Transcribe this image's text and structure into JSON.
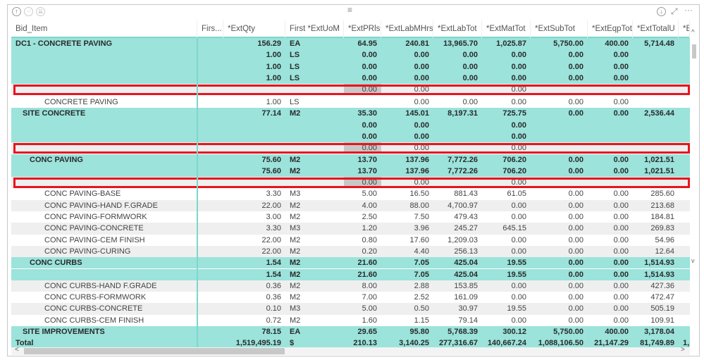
{
  "toolbar": {
    "drill_up": "↑",
    "drill_down": "↓↓",
    "expand": "⇊",
    "focus_mode": "⤢",
    "more": "···",
    "drag": "≡",
    "download": "↓"
  },
  "columns": [
    "Bid_Item",
    "Firs...",
    "*ExtQty",
    "First *ExtUoM",
    "*ExtPRls",
    "*ExtLabMHrs",
    "*ExtLabTot",
    "*ExtMatTot",
    "*ExtSubTot",
    "*ExtEqpTot",
    "*ExtTotalU",
    "*E"
  ],
  "colors": {
    "highlight": "#9be3db",
    "selection_box": "#e8141e",
    "stripe": "#efefef"
  },
  "rows": [
    {
      "style": "teal",
      "bold": true,
      "indent": 0,
      "cells": [
        "DC1 - CONCRETE PAVING",
        "",
        "156.29",
        "EA",
        "64.95",
        "240.81",
        "13,965.70",
        "1,025.87",
        "5,750.00",
        "400.00",
        "5,714.48",
        ""
      ]
    },
    {
      "style": "teal",
      "bold": true,
      "indent": 0,
      "cells": [
        "",
        "",
        "1.00",
        "LS",
        "0.00",
        "0.00",
        "0.00",
        "0.00",
        "0.00",
        "0.00",
        "",
        ""
      ]
    },
    {
      "style": "teal",
      "bold": true,
      "indent": 0,
      "cells": [
        "",
        "",
        "1.00",
        "LS",
        "0.00",
        "0.00",
        "0.00",
        "0.00",
        "0.00",
        "0.00",
        "",
        ""
      ]
    },
    {
      "style": "teal",
      "bold": true,
      "indent": 0,
      "cells": [
        "",
        "",
        "1.00",
        "LS",
        "0.00",
        "0.00",
        "0.00",
        "0.00",
        "0.00",
        "0.00",
        "",
        ""
      ]
    },
    {
      "style": "grey",
      "bold": false,
      "indent": 0,
      "selected": true,
      "cells": [
        "",
        "",
        "",
        "",
        "0.00",
        "0.00",
        "",
        "0.00",
        "",
        "",
        "",
        ""
      ]
    },
    {
      "style": "white",
      "bold": false,
      "indent": 3,
      "cells": [
        "CONCRETE PAVING",
        "",
        "1.00",
        "LS",
        "",
        "0.00",
        "0.00",
        "0.00",
        "0.00",
        "0.00",
        "",
        ""
      ]
    },
    {
      "style": "teal",
      "bold": true,
      "indent": 1,
      "cells": [
        "SITE CONCRETE",
        "",
        "77.14",
        "M2",
        "35.30",
        "145.01",
        "8,197.31",
        "725.75",
        "0.00",
        "0.00",
        "2,536.44",
        ""
      ]
    },
    {
      "style": "teal",
      "bold": true,
      "indent": 0,
      "cells": [
        "",
        "",
        "",
        "",
        "0.00",
        "0.00",
        "",
        "0.00",
        "",
        "",
        "",
        ""
      ]
    },
    {
      "style": "teal",
      "bold": true,
      "indent": 0,
      "cells": [
        "",
        "",
        "",
        "",
        "0.00",
        "0.00",
        "",
        "0.00",
        "",
        "",
        "",
        ""
      ]
    },
    {
      "style": "grey",
      "bold": false,
      "indent": 0,
      "selected": true,
      "cells": [
        "",
        "",
        "",
        "",
        "0.00",
        "0.00",
        "",
        "0.00",
        "",
        "",
        "",
        ""
      ]
    },
    {
      "style": "teal",
      "bold": true,
      "indent": 2,
      "cells": [
        "CONC PAVING",
        "",
        "75.60",
        "M2",
        "13.70",
        "137.96",
        "7,772.26",
        "706.20",
        "0.00",
        "0.00",
        "1,021.51",
        ""
      ]
    },
    {
      "style": "teal",
      "bold": true,
      "indent": 0,
      "cells": [
        "",
        "",
        "75.60",
        "M2",
        "13.70",
        "137.96",
        "7,772.26",
        "706.20",
        "0.00",
        "0.00",
        "1,021.51",
        ""
      ]
    },
    {
      "style": "grey",
      "bold": false,
      "indent": 0,
      "selected": true,
      "cells": [
        "",
        "",
        "",
        "",
        "0.00",
        "0.00",
        "",
        "0.00",
        "",
        "",
        "",
        ""
      ]
    },
    {
      "style": "white",
      "bold": false,
      "indent": 3,
      "cells": [
        "CONC PAVING-BASE",
        "",
        "3.30",
        "M3",
        "5.00",
        "16.50",
        "881.43",
        "61.05",
        "0.00",
        "0.00",
        "285.60",
        ""
      ]
    },
    {
      "style": "grey",
      "bold": false,
      "indent": 3,
      "cells": [
        "CONC PAVING-HAND F.GRADE",
        "",
        "22.00",
        "M2",
        "4.00",
        "88.00",
        "4,700.97",
        "0.00",
        "0.00",
        "0.00",
        "213.68",
        ""
      ]
    },
    {
      "style": "white",
      "bold": false,
      "indent": 3,
      "cells": [
        "CONC PAVING-FORMWORK",
        "",
        "3.00",
        "M2",
        "2.50",
        "7.50",
        "479.43",
        "0.00",
        "0.00",
        "0.00",
        "184.81",
        ""
      ]
    },
    {
      "style": "grey",
      "bold": false,
      "indent": 3,
      "cells": [
        "CONC PAVING-CONCRETE",
        "",
        "3.30",
        "M3",
        "1.20",
        "3.96",
        "245.27",
        "645.15",
        "0.00",
        "0.00",
        "269.83",
        ""
      ]
    },
    {
      "style": "white",
      "bold": false,
      "indent": 3,
      "cells": [
        "CONC PAVING-CEM FINISH",
        "",
        "22.00",
        "M2",
        "0.80",
        "17.60",
        "1,209.03",
        "0.00",
        "0.00",
        "0.00",
        "54.96",
        ""
      ]
    },
    {
      "style": "grey",
      "bold": false,
      "indent": 3,
      "cells": [
        "CONC PAVING-CURING",
        "",
        "22.00",
        "M2",
        "0.20",
        "4.40",
        "256.13",
        "0.00",
        "0.00",
        "0.00",
        "12.64",
        ""
      ]
    },
    {
      "style": "teal",
      "bold": true,
      "indent": 2,
      "cells": [
        "CONC CURBS",
        "",
        "1.54",
        "M2",
        "21.60",
        "7.05",
        "425.04",
        "19.55",
        "0.00",
        "0.00",
        "1,514.93",
        ""
      ]
    },
    {
      "style": "teal",
      "bold": true,
      "indent": 0,
      "cells": [
        "",
        "",
        "1.54",
        "M2",
        "21.60",
        "7.05",
        "425.04",
        "19.55",
        "0.00",
        "0.00",
        "1,514.93",
        ""
      ]
    },
    {
      "style": "grey",
      "bold": false,
      "indent": 3,
      "cells": [
        "CONC CURBS-HAND F.GRADE",
        "",
        "0.36",
        "M2",
        "8.00",
        "2.88",
        "153.85",
        "0.00",
        "0.00",
        "0.00",
        "427.36",
        ""
      ]
    },
    {
      "style": "white",
      "bold": false,
      "indent": 3,
      "cells": [
        "CONC CURBS-FORMWORK",
        "",
        "0.36",
        "M2",
        "7.00",
        "2.52",
        "161.09",
        "0.00",
        "0.00",
        "0.00",
        "472.47",
        ""
      ]
    },
    {
      "style": "grey",
      "bold": false,
      "indent": 3,
      "cells": [
        "CONC CURBS-CONCRETE",
        "",
        "0.10",
        "M3",
        "5.00",
        "0.50",
        "30.97",
        "19.55",
        "0.00",
        "0.00",
        "505.19",
        ""
      ]
    },
    {
      "style": "white",
      "bold": false,
      "indent": 3,
      "cells": [
        "CONC CURBS-CEM FINISH",
        "",
        "0.72",
        "M2",
        "1.60",
        "1.15",
        "79.14",
        "0.00",
        "0.00",
        "0.00",
        "109.91",
        ""
      ]
    },
    {
      "style": "teal",
      "bold": true,
      "indent": 1,
      "cells": [
        "SITE IMPROVEMENTS",
        "",
        "78.15",
        "EA",
        "29.65",
        "95.80",
        "5,768.39",
        "300.12",
        "5,750.00",
        "400.00",
        "3,178.04",
        ""
      ]
    },
    {
      "style": "teal",
      "bold": true,
      "indent": 0,
      "total": true,
      "cells": [
        "Total",
        "",
        "1,519,495.19",
        "$",
        "210.13",
        "3,140.25",
        "277,316.67",
        "140,667.24",
        "1,088,106.50",
        "21,147.29",
        "81,749.89",
        "1,"
      ]
    }
  ],
  "scroll": {
    "left": "<",
    "right": ">",
    "up": "^",
    "down": "v"
  }
}
